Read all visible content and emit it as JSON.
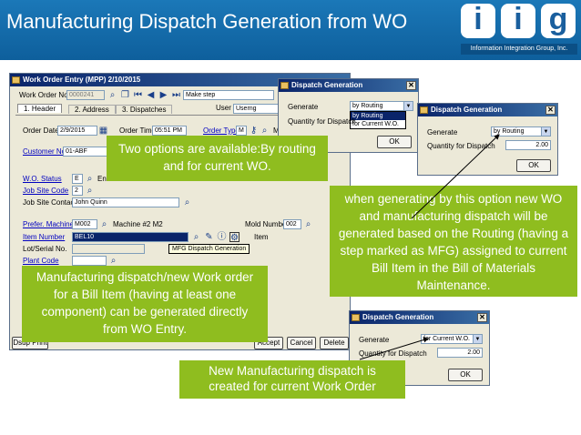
{
  "slide": {
    "title": "Manufacturing Dispatch Generation  from WO",
    "logo_letters": [
      "i",
      "i",
      "g"
    ],
    "logo_caption": "Information Integration Group, Inc."
  },
  "woe": {
    "title": "Work Order Entry (MPP) 2/10/2015",
    "wo_no_label": "Work Order No.",
    "wo_no_value": "0000241",
    "step_value": "Make step",
    "tabs": [
      "1. Header",
      "2. Address",
      "3. Dispatches"
    ],
    "user_label": "User",
    "user_value": "Userng",
    "order_date_label": "Order Date",
    "order_date_value": "2/9/2015",
    "order_time_label": "Order Time",
    "order_time_value": "05:51 PM",
    "order_type_label": "Order Type",
    "order_type_value": "M",
    "order_type_trail": "M",
    "customer_no_label": "Customer No.",
    "customer_no_value": "01-ABF",
    "wo_status_label": "W.O. Status",
    "wo_status_value": "E",
    "wo_status_trail": "Ente",
    "job_site_code_label": "Job Site Code",
    "job_site_code_value": "2",
    "job_site_contact_label": "Job Site Contact",
    "job_site_contact_value": "John Quinn",
    "prefer_machine_label": "Prefer. Machine",
    "prefer_machine_value": "M002",
    "machine_desc": "Machine #2 M2",
    "mold_number_label": "Mold Number",
    "mold_number_value": "002",
    "item_number_label": "Item Number",
    "item_number_value": "BEL10",
    "item_trail": "Item",
    "tooltip": "MFG Dispatch Generation",
    "lot_serial_label": "Lot/Serial No.",
    "plant_code_label": "Plant Code",
    "buttons": [
      "Accept",
      "Cancel",
      "Delete"
    ],
    "bottom_left_btn": "Dsup Print"
  },
  "dlg1": {
    "title": "Dispatch Generation",
    "generate_label": "Generate",
    "generate_value": "by Routing",
    "options": [
      "by Routing",
      "for Current W.O."
    ],
    "qty_label": "Quantity for Dispatch",
    "ok_label": "OK"
  },
  "dlg2": {
    "title": "Dispatch Generation",
    "generate_label": "Generate",
    "generate_value": "by Routing",
    "qty_label": "Quantity for Dispatch",
    "qty_value": "2.00",
    "ok_label": "OK"
  },
  "dlg3": {
    "title": "Dispatch Generation",
    "generate_label": "Generate",
    "generate_value": "for Current W.O.",
    "qty_label": "Quantity for Dispatch",
    "qty_value": "2.00",
    "ok_label": "OK"
  },
  "callouts": {
    "two_options": "Two options are available:By routing and for current WO.",
    "manufacturing": "Manufacturing dispatch/new Work order for a Bill Item (having at least one component) can be generated directly from WO Entry.",
    "routing": "when generating by this option new WO and manufacturing dispatch will be generated based on the Routing (having a step marked as MFG) assigned to current Bill Item in the Bill of Materials Maintenance.",
    "new_dispatch": "New Manufacturing dispatch is created for current Work Order"
  },
  "colors": {
    "banner": "#1b78b8",
    "callout": "#8fbd1f",
    "title_bar": "#0a246a"
  }
}
